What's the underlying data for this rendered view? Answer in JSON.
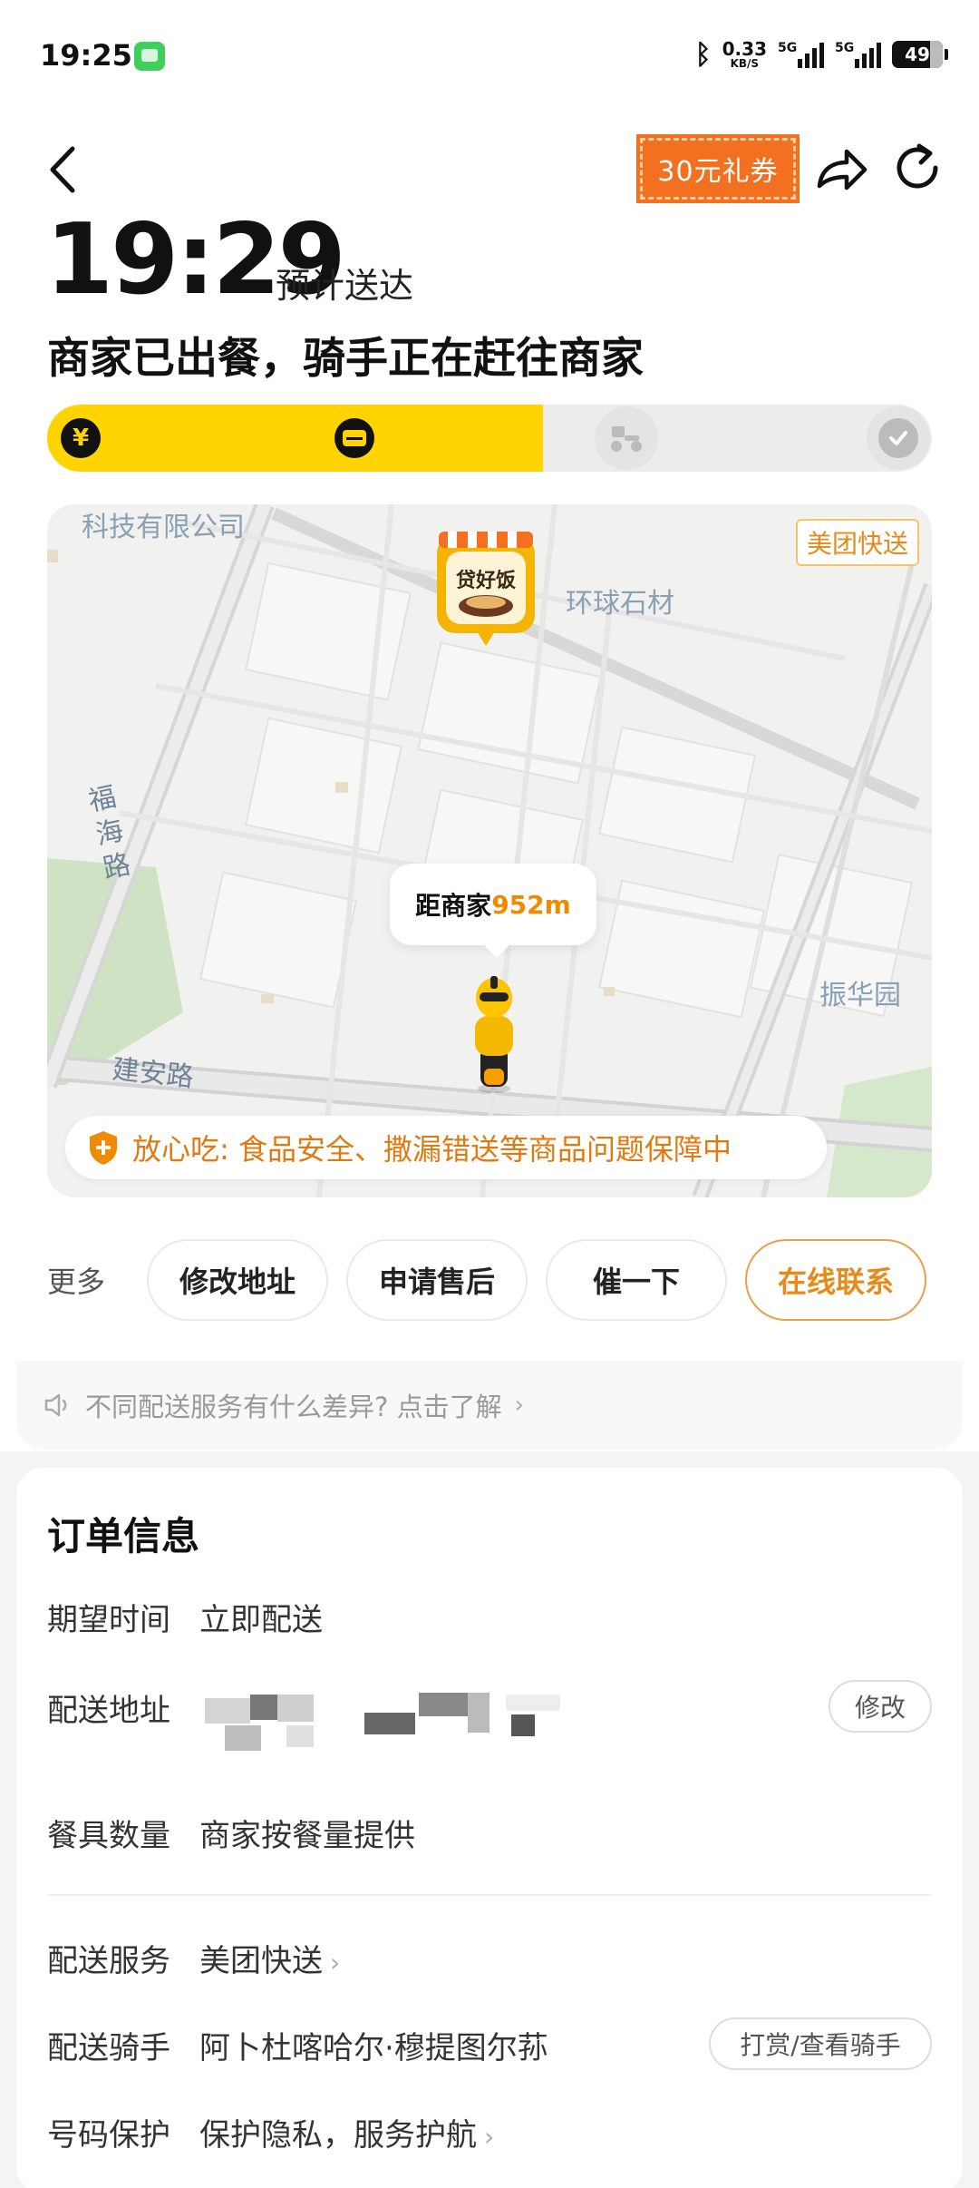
{
  "status_bar": {
    "time": "19:25",
    "net_speed": "0.33",
    "net_unit": "KB/S",
    "signal1_label": "5G",
    "signal2_label": "5G",
    "battery": "49"
  },
  "header": {
    "coupon_label": "30元礼券",
    "eta_time": "19:29",
    "eta_label": "预计送达",
    "headline": "商家已出餐，骑手正在赶往商家"
  },
  "progress": {
    "fraction": 0.56,
    "steps": [
      {
        "icon": "yen-icon",
        "state": "done"
      },
      {
        "icon": "store-icon",
        "state": "done"
      },
      {
        "icon": "scooter-icon",
        "state": "pending"
      },
      {
        "icon": "check-shield-icon",
        "state": "pending"
      }
    ]
  },
  "map": {
    "labels": {
      "company": "科技有限公司",
      "stone": "环球石材",
      "garden": "振华园",
      "road_fuhai": "福海路",
      "road_jianan": "建安路"
    },
    "express_tag": "美团快送",
    "shop_logo_text": "贷好饭",
    "distance_prefix": "距商家",
    "distance_value": "952m",
    "guarantee": "放心吃: 食品安全、撒漏错送等商品问题保障中"
  },
  "actions": {
    "more_label": "更多",
    "buttons": [
      "修改地址",
      "申请售后",
      "催一下",
      "在线联系"
    ]
  },
  "notice": {
    "text": "不同配送服务有什么差异? 点击了解"
  },
  "order": {
    "title": "订单信息",
    "expected_time_label": "期望时间",
    "expected_time_value": "立即配送",
    "address_label": "配送地址",
    "address_edit": "修改",
    "tableware_label": "餐具数量",
    "tableware_value": "商家按餐量提供",
    "service_label": "配送服务",
    "service_value": "美团快送",
    "rider_label": "配送骑手",
    "rider_value": "阿卜杜喀哈尔·穆提图尔荪",
    "rider_button": "打赏/查看骑手",
    "privacy_label": "号码保护",
    "privacy_value": "保护隐私，服务护航"
  },
  "colors": {
    "brand_yellow": "#ffd400",
    "accent_orange": "#f08a00",
    "coupon_orange": "#f37021"
  }
}
